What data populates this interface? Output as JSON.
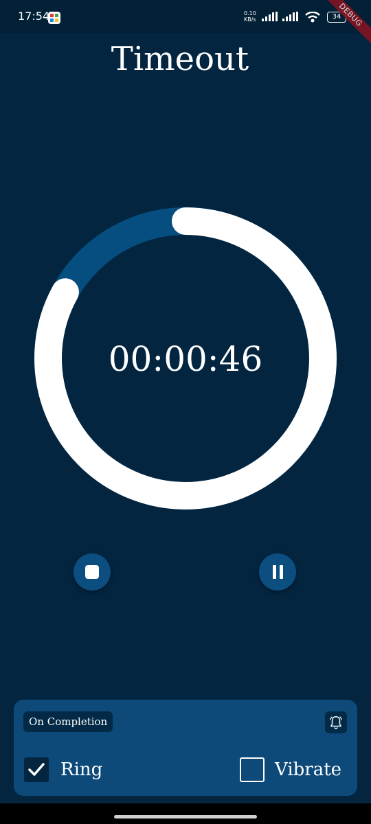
{
  "status_bar": {
    "time": "17:54",
    "net_speed_value": "0.10",
    "net_speed_unit": "KB/s",
    "battery": "34",
    "app_icon": "puzzle-app-icon",
    "icons": [
      "signal-icon",
      "signal-icon",
      "wifi-icon",
      "battery-icon"
    ]
  },
  "debug_banner": "DEBUG",
  "app": {
    "title": "Timeout"
  },
  "timer": {
    "display": "00:00:46",
    "remaining_fraction": 0.83,
    "colors": {
      "ring_fill": "#ffffff",
      "ring_track": "#064e80"
    }
  },
  "controls": {
    "stop_icon": "stop-icon",
    "pause_icon": "pause-icon"
  },
  "completion": {
    "chip_label": "On Completion",
    "bell_icon": "bell-icon",
    "options": [
      {
        "label": "Ring",
        "checked": true
      },
      {
        "label": "Vibrate",
        "checked": false
      }
    ]
  },
  "colors": {
    "background": "#032540",
    "panel": "#0d4a79",
    "button": "#0c4e80"
  }
}
